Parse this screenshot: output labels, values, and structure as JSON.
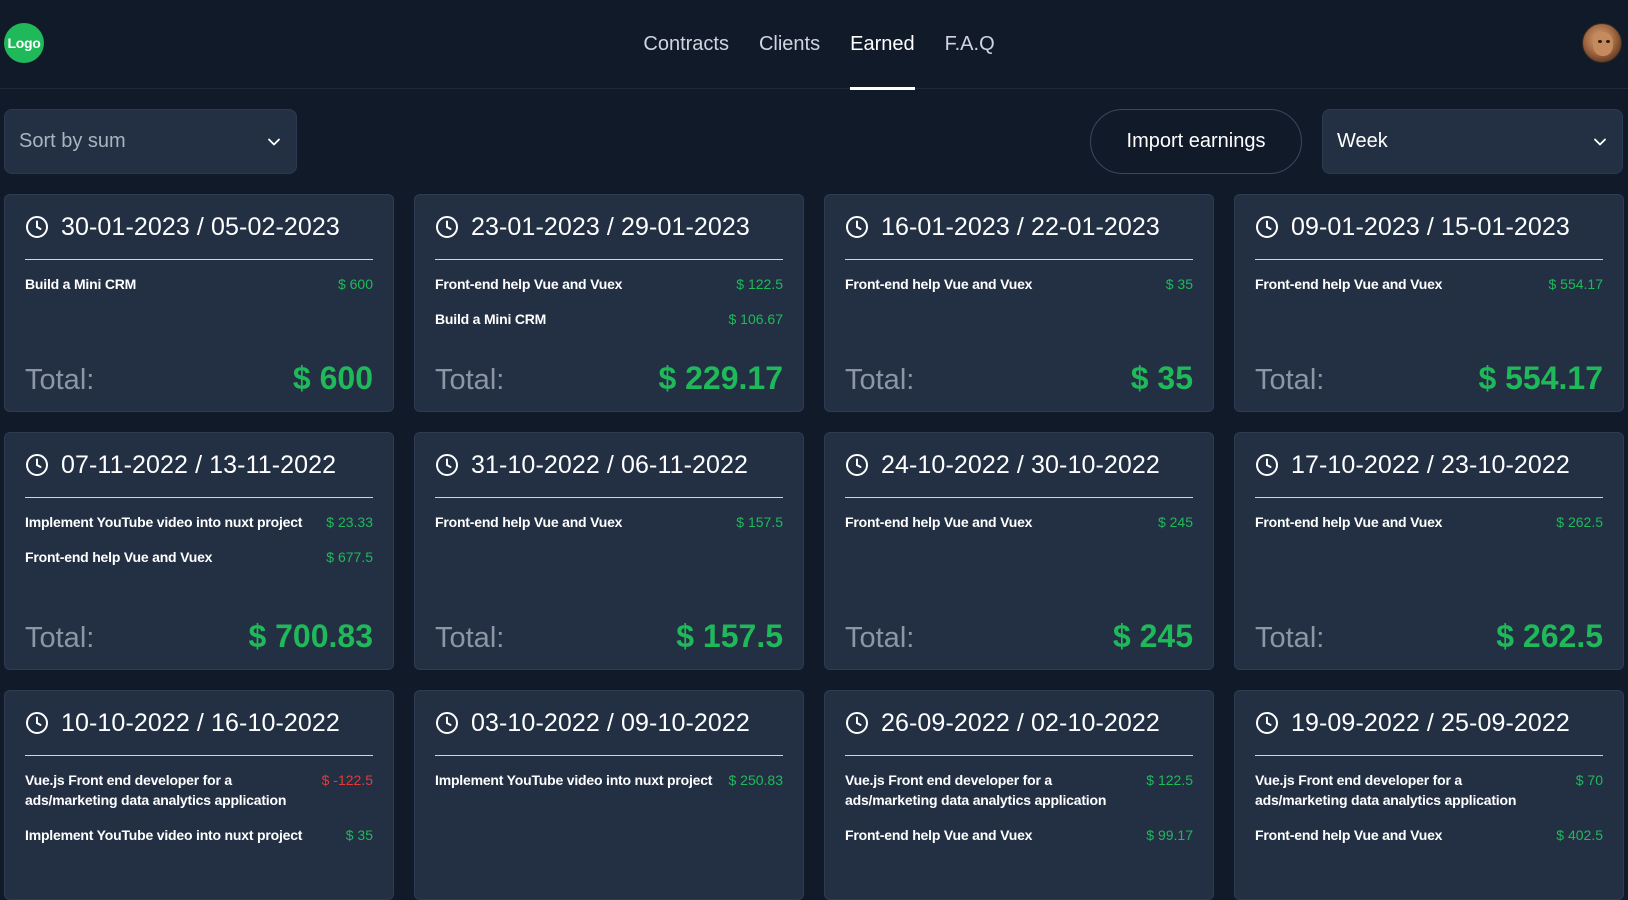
{
  "header": {
    "logo_text": "Logo",
    "nav": [
      {
        "label": "Contracts",
        "active": false
      },
      {
        "label": "Clients",
        "active": false
      },
      {
        "label": "Earned",
        "active": true
      },
      {
        "label": "F.A.Q",
        "active": false
      }
    ]
  },
  "toolbar": {
    "sort_value": "Sort by sum",
    "import_label": "Import earnings",
    "period_value": "Week"
  },
  "labels": {
    "total": "Total:"
  },
  "colors": {
    "accent_green": "#1fb95a",
    "negative_red": "#e23b3b",
    "card_bg": "#233044",
    "page_bg": "#111a29"
  },
  "cards": [
    {
      "period": "30-01-2023 / 05-02-2023",
      "items": [
        {
          "name": "Build a Mini CRM",
          "amount": "$ 600"
        }
      ],
      "total": "$ 600"
    },
    {
      "period": "23-01-2023 / 29-01-2023",
      "items": [
        {
          "name": "Front-end help Vue and Vuex",
          "amount": "$ 122.5"
        },
        {
          "name": "Build a Mini CRM",
          "amount": "$ 106.67"
        }
      ],
      "total": "$ 229.17"
    },
    {
      "period": "16-01-2023 / 22-01-2023",
      "items": [
        {
          "name": "Front-end help Vue and Vuex",
          "amount": "$ 35"
        }
      ],
      "total": "$ 35"
    },
    {
      "period": "09-01-2023 / 15-01-2023",
      "items": [
        {
          "name": "Front-end help Vue and Vuex",
          "amount": "$ 554.17"
        }
      ],
      "total": "$ 554.17"
    },
    {
      "period": "07-11-2022 / 13-11-2022",
      "items": [
        {
          "name": "Implement YouTube video into nuxt project",
          "amount": "$ 23.33"
        },
        {
          "name": "Front-end help Vue and Vuex",
          "amount": "$ 677.5"
        }
      ],
      "total": "$ 700.83"
    },
    {
      "period": "31-10-2022 / 06-11-2022",
      "items": [
        {
          "name": "Front-end help Vue and Vuex",
          "amount": "$ 157.5"
        }
      ],
      "total": "$ 157.5"
    },
    {
      "period": "24-10-2022 / 30-10-2022",
      "items": [
        {
          "name": "Front-end help Vue and Vuex",
          "amount": "$ 245"
        }
      ],
      "total": "$ 245"
    },
    {
      "period": "17-10-2022 / 23-10-2022",
      "items": [
        {
          "name": "Front-end help Vue and Vuex",
          "amount": "$ 262.5"
        }
      ],
      "total": "$ 262.5"
    },
    {
      "period": "10-10-2022 / 16-10-2022",
      "items": [
        {
          "name": "Vue.js Front end developer for a ads/marketing data analytics application",
          "amount": "$ -122.5",
          "negative": true
        },
        {
          "name": "Implement YouTube video into nuxt project",
          "amount": "$ 35"
        }
      ],
      "total": ""
    },
    {
      "period": "03-10-2022 / 09-10-2022",
      "items": [
        {
          "name": "Implement YouTube video into nuxt project",
          "amount": "$ 250.83"
        }
      ],
      "total": ""
    },
    {
      "period": "26-09-2022 / 02-10-2022",
      "items": [
        {
          "name": "Vue.js Front end developer for a ads/marketing data analytics application",
          "amount": "$ 122.5"
        },
        {
          "name": "Front-end help Vue and Vuex",
          "amount": "$ 99.17"
        }
      ],
      "total": ""
    },
    {
      "period": "19-09-2022 / 25-09-2022",
      "items": [
        {
          "name": "Vue.js Front end developer for a ads/marketing data analytics application",
          "amount": "$ 70"
        },
        {
          "name": "Front-end help Vue and Vuex",
          "amount": "$ 402.5"
        }
      ],
      "total": ""
    }
  ]
}
